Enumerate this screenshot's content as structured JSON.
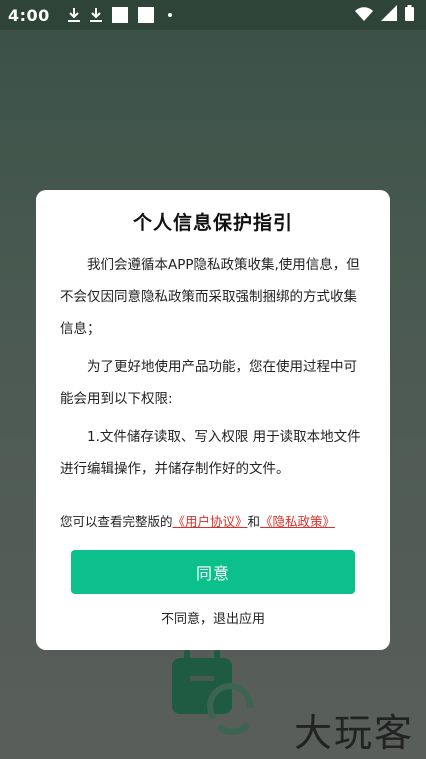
{
  "status_bar": {
    "time": "4:00",
    "icons_left": [
      "download-icon",
      "download-icon",
      "white-square-icon",
      "white-square-icon",
      "dot-icon"
    ],
    "icons_right": [
      "wifi-icon",
      "signal-icon",
      "battery-icon"
    ]
  },
  "dialog": {
    "title": "个人信息保护指引",
    "paragraphs": [
      "我们会遵循本APP隐私政策收集,使用信息，但不会仅因同意隐私政策而采取强制捆绑的方式收集信息；",
      "为了更好地使用产品功能，您在使用过程中可能会用到以下权限:",
      "1.文件储存读取、写入权限 用于读取本地文件进行编辑操作，并储存制作好的文件。"
    ],
    "notice_prefix": "您可以查看完整版的",
    "user_agreement_link": "《用户协议》",
    "notice_and": "和",
    "privacy_policy_link": "《隐私政策》",
    "agree_label": "同意",
    "disagree_label": "不同意，退出应用"
  },
  "background": {
    "watermark": "大玩客"
  },
  "colors": {
    "accent_green": "#0bc08a",
    "link_red": "#d9302c",
    "status_bar": "#2e4438"
  }
}
